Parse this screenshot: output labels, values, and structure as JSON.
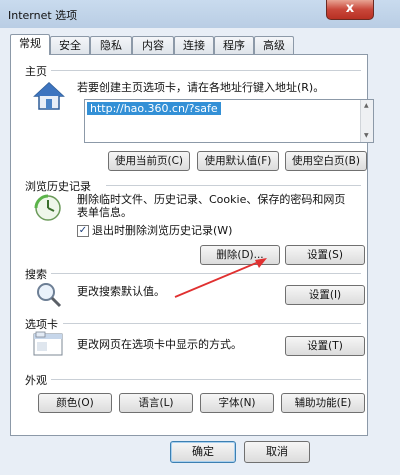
{
  "window": {
    "title": "Internet 选项",
    "close_label": "x"
  },
  "tabs": [
    {
      "label": "常规",
      "active": true
    },
    {
      "label": "安全"
    },
    {
      "label": "隐私"
    },
    {
      "label": "内容"
    },
    {
      "label": "连接"
    },
    {
      "label": "程序"
    },
    {
      "label": "高级"
    }
  ],
  "home": {
    "heading": "主页",
    "desc": "若要创建主页选项卡，请在各地址行键入地址(R)。",
    "url": "http://hao.360.cn/?safe",
    "btn_current": "使用当前页(C)",
    "btn_default": "使用默认值(F)",
    "btn_blank": "使用空白页(B)"
  },
  "history": {
    "heading": "浏览历史记录",
    "desc_line1": "删除临时文件、历史记录、Cookie、保存的密码和网页",
    "desc_line2": "表单信息。",
    "checkbox_label": "退出时删除浏览历史记录(W)",
    "checkbox_checked": "✓",
    "btn_delete": "删除(D)...",
    "btn_settings": "设置(S)"
  },
  "search": {
    "heading": "搜索",
    "desc": "更改搜索默认值。",
    "btn_settings": "设置(I)"
  },
  "tabs_section": {
    "heading": "选项卡",
    "desc": "更改网页在选项卡中显示的方式。",
    "btn_settings": "设置(T)"
  },
  "appearance": {
    "heading": "外观",
    "btn_colors": "颜色(O)",
    "btn_languages": "语言(L)",
    "btn_fonts": "字体(N)",
    "btn_accessibility": "辅助功能(E)"
  },
  "footer": {
    "btn_ok": "确定",
    "btn_cancel": "取消"
  },
  "colors": {
    "accent": "#3390d6",
    "annotation_arrow": "#e03030"
  }
}
